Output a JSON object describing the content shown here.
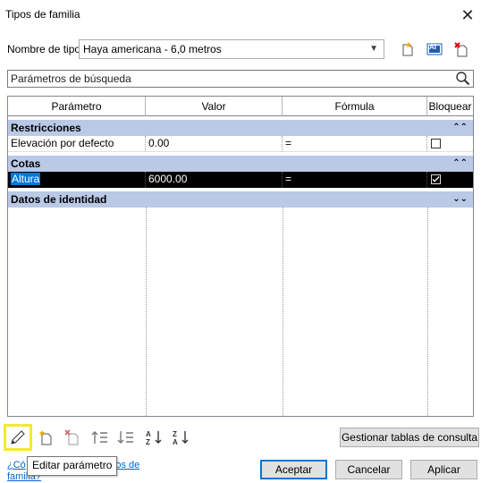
{
  "window": {
    "title": "Tipos de familia",
    "close_glyph": "✕"
  },
  "type_row": {
    "label": "Nombre de tipo:",
    "selected_value": "Haya americana - 6,0 metros",
    "icons": [
      "new-type-icon",
      "rename-type-icon",
      "delete-type-icon"
    ],
    "rename_glyph": "AI"
  },
  "search": {
    "placeholder": "Parámetros de búsqueda"
  },
  "grid": {
    "columns": [
      "Parámetro",
      "Valor",
      "Fórmula",
      "Bloquear"
    ],
    "groups": [
      {
        "name": "Restricciones",
        "chevron": "⌃⌃",
        "rows": [
          {
            "param": "Elevación por defecto",
            "value": "0.00",
            "formula": "=",
            "locked": false
          }
        ]
      },
      {
        "name": "Cotas",
        "chevron": "⌃⌃",
        "rows": [
          {
            "param": "Altura",
            "value": "6000.00",
            "formula": "=",
            "locked": true,
            "selected": true
          }
        ]
      },
      {
        "name": "Datos de identidad",
        "chevron": "⌄⌄",
        "rows": []
      }
    ]
  },
  "toolbar": {
    "buttons": [
      "edit-parameter",
      "new-parameter",
      "delete-parameter",
      "move-up",
      "move-down",
      "sort-ascending",
      "sort-descending"
    ],
    "manage_lookup_tables": "Gestionar tablas de consulta",
    "highlight_color": "#f2ea2f"
  },
  "tooltip": {
    "text": "Editar parámetro"
  },
  "help_link": {
    "line1_start": "¿Có",
    "line1_end": "ipos de",
    "line2": "familia?"
  },
  "buttons": {
    "ok": "Aceptar",
    "cancel": "Cancelar",
    "apply": "Aplicar"
  },
  "colors": {
    "group_header_bg": "#b9c9e6",
    "selection_bg": "#000000",
    "selection_label_bg": "#0078d7",
    "link": "#0066cc"
  }
}
